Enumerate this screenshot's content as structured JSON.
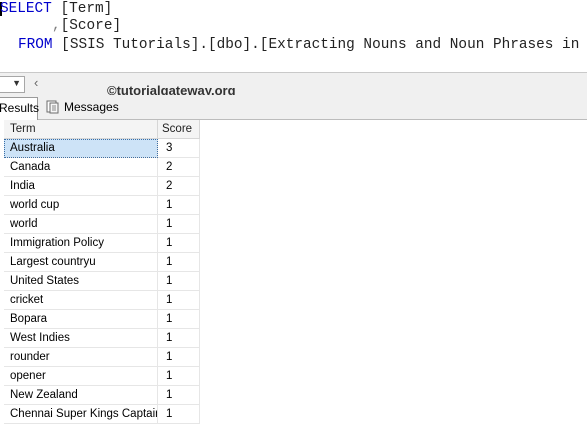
{
  "query": {
    "line1_kw": "SELECT",
    "line1_rest": " [Term]",
    "line2_sep": ",",
    "line2_rest": "[Score]",
    "line3_kw": "FROM",
    "line3_rest": " [SSIS Tutorials].[dbo].[Extracting Nouns and Noun Phrases in SSIS]"
  },
  "watermark": "©tutorialgateway.org",
  "tabs": {
    "results": "Results",
    "messages": "Messages"
  },
  "grid": {
    "headers": [
      "Term",
      "Score"
    ],
    "rows": [
      {
        "term": "Australia",
        "score": "3"
      },
      {
        "term": "Canada",
        "score": "2"
      },
      {
        "term": "India",
        "score": "2"
      },
      {
        "term": "world cup",
        "score": "1"
      },
      {
        "term": "world",
        "score": "1"
      },
      {
        "term": "Immigration Policy",
        "score": "1"
      },
      {
        "term": "Largest countryu",
        "score": "1"
      },
      {
        "term": "United States",
        "score": "1"
      },
      {
        "term": "cricket",
        "score": "1"
      },
      {
        "term": "Bopara",
        "score": "1"
      },
      {
        "term": "West Indies",
        "score": "1"
      },
      {
        "term": "rounder",
        "score": "1"
      },
      {
        "term": "opener",
        "score": "1"
      },
      {
        "term": "New Zealand",
        "score": "1"
      },
      {
        "term": "Chennai Super Kings Captain",
        "score": "1"
      }
    ]
  }
}
